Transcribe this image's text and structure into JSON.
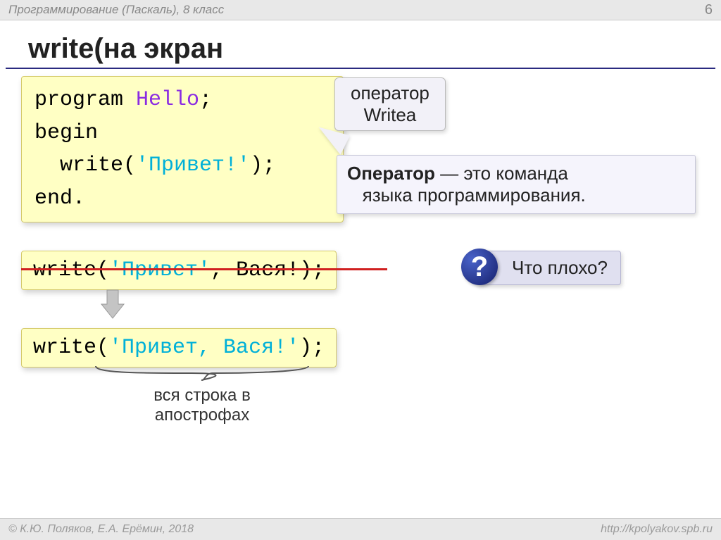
{
  "header": {
    "title": "Программирование (Паскаль), 8 класс",
    "page": "6"
  },
  "title": "write(на экран",
  "code": {
    "l1a": "program",
    "l1b": " Hello",
    "l1c": ";",
    "l2": "begin",
    "l3a": "  write(",
    "l3b": "'Привет!'",
    "l3c": ");",
    "l4": "end."
  },
  "callout": {
    "l1": "оператор",
    "l2": "Writea"
  },
  "definition": {
    "term": "Оператор",
    "dash": " — ",
    "rest1": "это команда",
    "rest2": "языка программирования."
  },
  "bad": {
    "a": "write(",
    "b": "'Привет'",
    "c": ", Вася!);"
  },
  "good": {
    "a": "write(",
    "b": "'Привет, Вася!'",
    "c": ");"
  },
  "question": "Что плохо?",
  "brace_label": {
    "l1": "вся строка в",
    "l2": "апострофах"
  },
  "footer": {
    "left": "© К.Ю. Поляков, Е.А. Ерёмин, 2018",
    "right": "http://kpolyakov.spb.ru"
  }
}
